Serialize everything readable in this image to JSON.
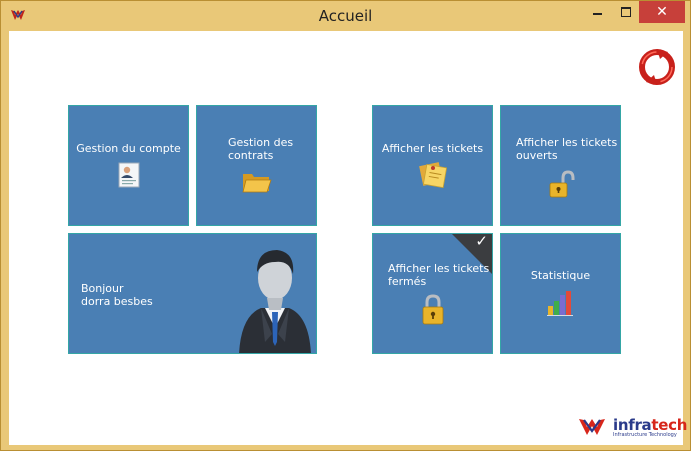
{
  "window": {
    "title": "Accueil",
    "close_glyph": "✕"
  },
  "tiles": {
    "account": {
      "label": "Gestion du compte",
      "icon": "user-card-icon"
    },
    "contracts": {
      "label_line1": "Gestion des",
      "label_line2": "contrats",
      "icon": "folder-icon"
    },
    "greeting": {
      "line1": "Bonjour",
      "line2": "dorra besbes",
      "icon": "user-avatar-icon"
    },
    "tickets": {
      "label": "Afficher les tickets",
      "icon": "sticky-notes-icon"
    },
    "open_tickets": {
      "label_line1": "Afficher les tickets",
      "label_line2": "ouverts",
      "icon": "unlocked-padlock-icon"
    },
    "closed_tickets": {
      "label_line1": "Afficher les tickets",
      "label_line2": "fermés",
      "icon": "locked-padlock-icon",
      "checkmark": "✓"
    },
    "statistics": {
      "label": "Statistique",
      "icon": "bar-chart-icon"
    }
  },
  "logo": {
    "name_part1": "infra",
    "name_part2": "tech",
    "tagline": "Infrastructure Technology"
  },
  "colors": {
    "frame": "#e9c878",
    "tile": "#4a7fb4",
    "tile_border": "#34a6a6",
    "close": "#c7403a"
  }
}
